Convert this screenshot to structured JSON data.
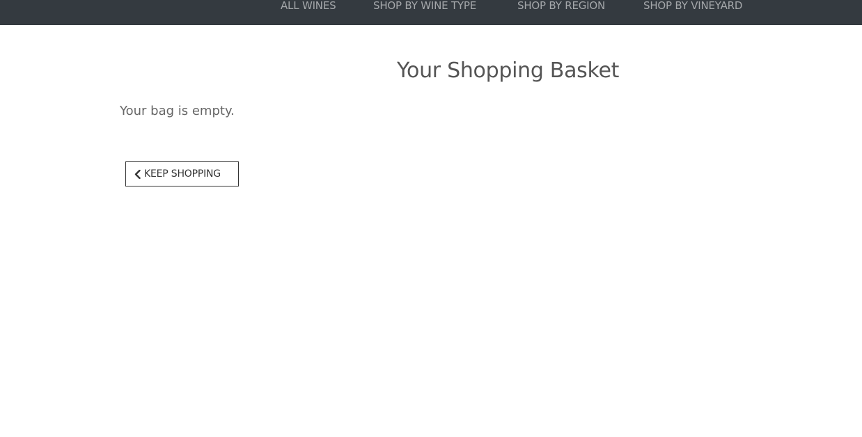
{
  "nav": {
    "items": [
      {
        "label": "ALL WINES"
      },
      {
        "label": "SHOP BY WINE TYPE"
      },
      {
        "label": "SHOP BY REGION"
      },
      {
        "label": "SHOP BY VINEYARD"
      }
    ]
  },
  "main": {
    "title": "Your Shopping Basket",
    "empty_message": "Your bag is empty.",
    "keep_shopping": {
      "icon": "chevron-left-icon",
      "label": "KEEP SHOPPING"
    }
  },
  "colors": {
    "nav_background": "#343a40",
    "nav_text": "#a4a7aa",
    "title_text": "#555555",
    "body_text": "#666666",
    "button_border": "#333333"
  }
}
